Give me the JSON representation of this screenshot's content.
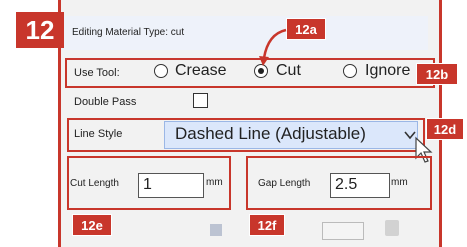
{
  "step_badge": "12",
  "window": {
    "title": "Editing Material Type: cut"
  },
  "callouts": {
    "a": "12a",
    "b": "12b",
    "d": "12d",
    "e": "12e",
    "f": "12f"
  },
  "use_tool": {
    "label": "Use Tool:",
    "options": [
      "Crease",
      "Cut",
      "Ignore"
    ],
    "selected": "Cut"
  },
  "double_pass": {
    "label": "Double Pass",
    "checked": false
  },
  "line_style": {
    "label": "Line Style",
    "value": "Dashed Line (Adjustable)"
  },
  "cut_length": {
    "label": "Cut Length",
    "value": "1",
    "unit": "mm"
  },
  "gap_length": {
    "label": "Gap Length",
    "value": "2.5",
    "unit": "mm"
  },
  "colors": {
    "accent": "#c8362b",
    "select_bg": "#dbe7fb",
    "panel": "#f2f2f2"
  }
}
